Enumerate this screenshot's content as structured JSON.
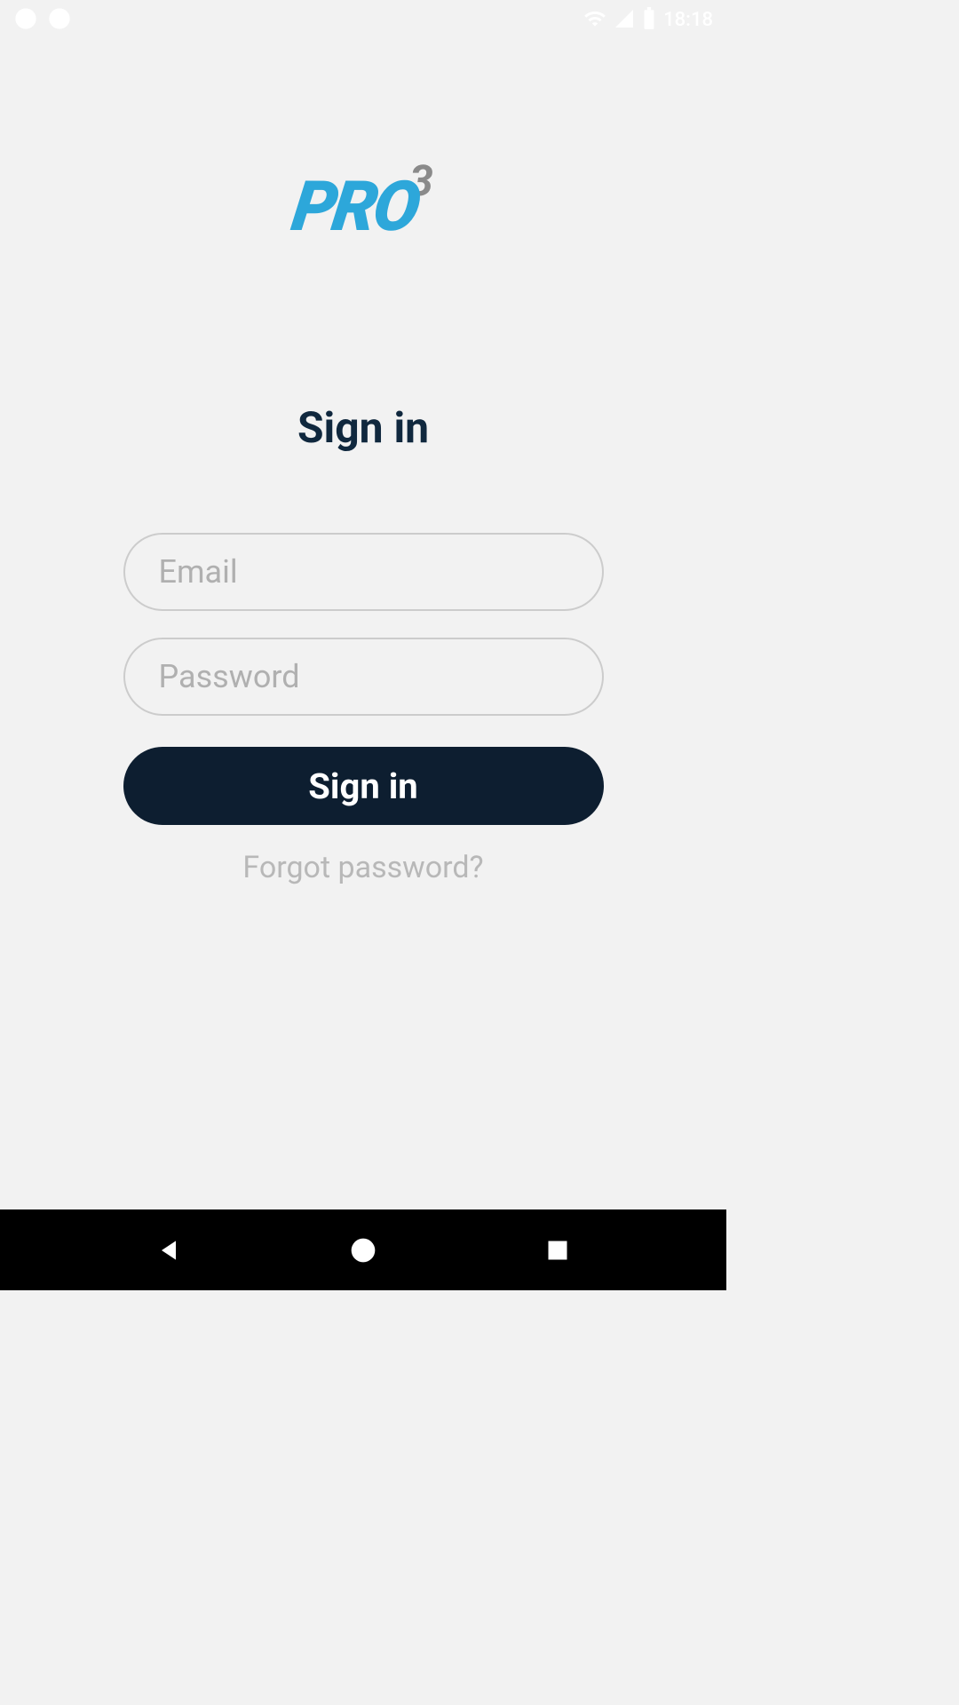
{
  "statusBar": {
    "time": "18:18"
  },
  "logo": {
    "text": "PRO",
    "sup": "3"
  },
  "title": "Sign in",
  "form": {
    "emailPlaceholder": "Email",
    "passwordPlaceholder": "Password",
    "emailValue": "",
    "passwordValue": ""
  },
  "buttons": {
    "signIn": "Sign in",
    "forgotPassword": "Forgot password?"
  },
  "colors": {
    "accent": "#2DA7DA",
    "dark": "#0d1e30",
    "gray": "#8a8a8a",
    "lightGray": "#b0b0b0",
    "background": "#f2f2f2"
  }
}
